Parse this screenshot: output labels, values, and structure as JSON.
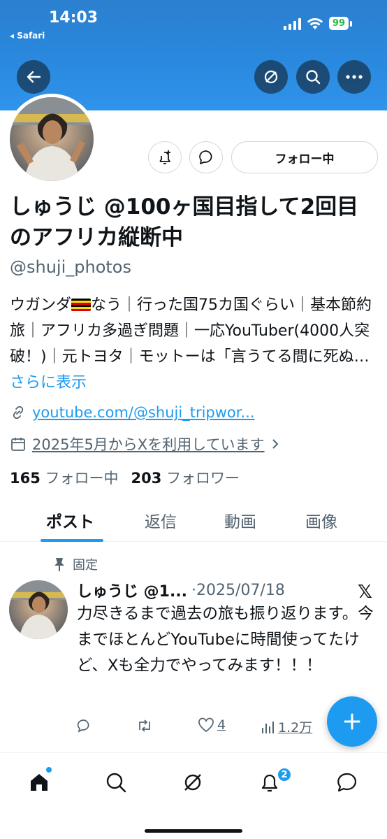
{
  "status_bar": {
    "time": "14:03",
    "back_app": "◂ Safari",
    "battery": "99"
  },
  "profile": {
    "display_name": "しゅうじ @100ヶ国目指して2回目のアフリカ縦断中",
    "handle": "@shuji_photos",
    "bio_part1": "ウガンダ",
    "bio_part2": "なう｜行った国75カ国ぐらい｜基本節約旅｜アフリカ多過ぎ問題｜一応YouTuber(4000人突破！)｜元トヨタ｜モットーは「言うてる間に死ぬ…",
    "bio_more": "さらに表示",
    "link": "youtube.com/@shuji_tripwor...",
    "joined": "2025年5月からXを利用しています",
    "following_count": "165",
    "following_label": "フォロー中",
    "followers_count": "203",
    "followers_label": "フォロワー",
    "follow_button": "フォロー中"
  },
  "tabs": [
    {
      "label": "ポスト"
    },
    {
      "label": "返信"
    },
    {
      "label": "動画"
    },
    {
      "label": "画像"
    }
  ],
  "post": {
    "pinned_label": "固定",
    "author": "しゅうじ @1...",
    "date": "·2025/07/18",
    "text": "力尽きるまで過去の旅も振り返ります。今までほとんどYouTubeに時間使ってたけど、Xも全力でやってみます！！！",
    "likes": "4",
    "views": "1.2万"
  },
  "bottom_nav": {
    "notifications_badge": "2"
  },
  "colors": {
    "accent": "#1d9bf0",
    "banner": "#2a8ae0",
    "text": "#0f1419",
    "secondary": "#536471"
  }
}
